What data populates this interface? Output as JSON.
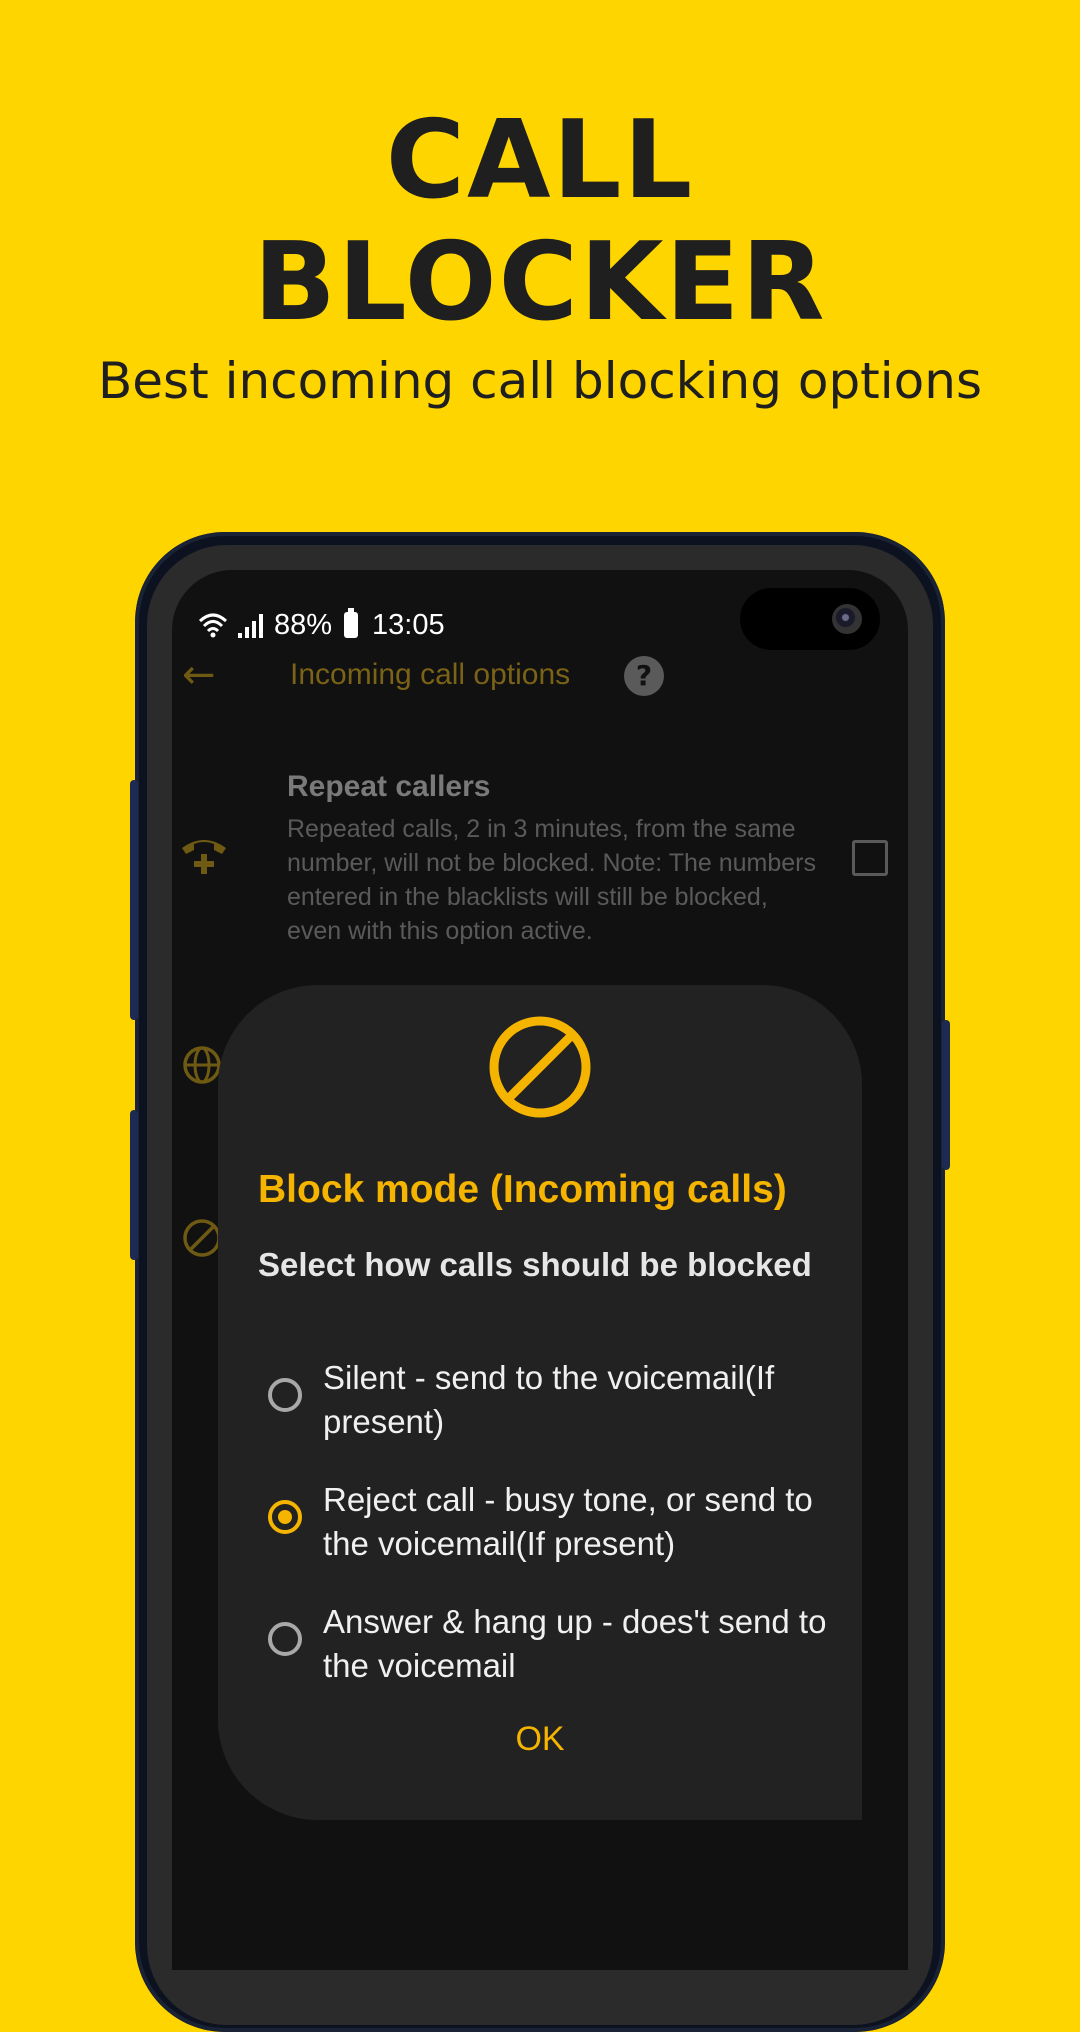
{
  "promo": {
    "title_line1": "CALL",
    "title_line2": "BLOCKER",
    "subtitle": "Best incoming call blocking options"
  },
  "status_bar": {
    "battery_percent": "88%",
    "time": "13:05"
  },
  "app_bar": {
    "title": "Incoming call options",
    "help": "?"
  },
  "setting": {
    "title": "Repeat callers",
    "description": "Repeated calls, 2 in 3 minutes, from the same number, will not be blocked. Note: The numbers entered in the blacklists will still be blocked, even with this option active.",
    "checked": false
  },
  "dialog": {
    "title": "Block mode (Incoming calls)",
    "subtitle": "Select how calls should be blocked",
    "options": [
      {
        "label": "Silent - send to the voicemail(If present)",
        "selected": false
      },
      {
        "label": "Reject call - busy tone, or send to the voicemail(If present)",
        "selected": true
      },
      {
        "label": "Answer & hang up - does't send to the voicemail",
        "selected": false
      }
    ],
    "ok_label": "OK"
  },
  "colors": {
    "background": "#FFD500",
    "accent": "#F5B400",
    "dialog_bg": "#222222"
  }
}
